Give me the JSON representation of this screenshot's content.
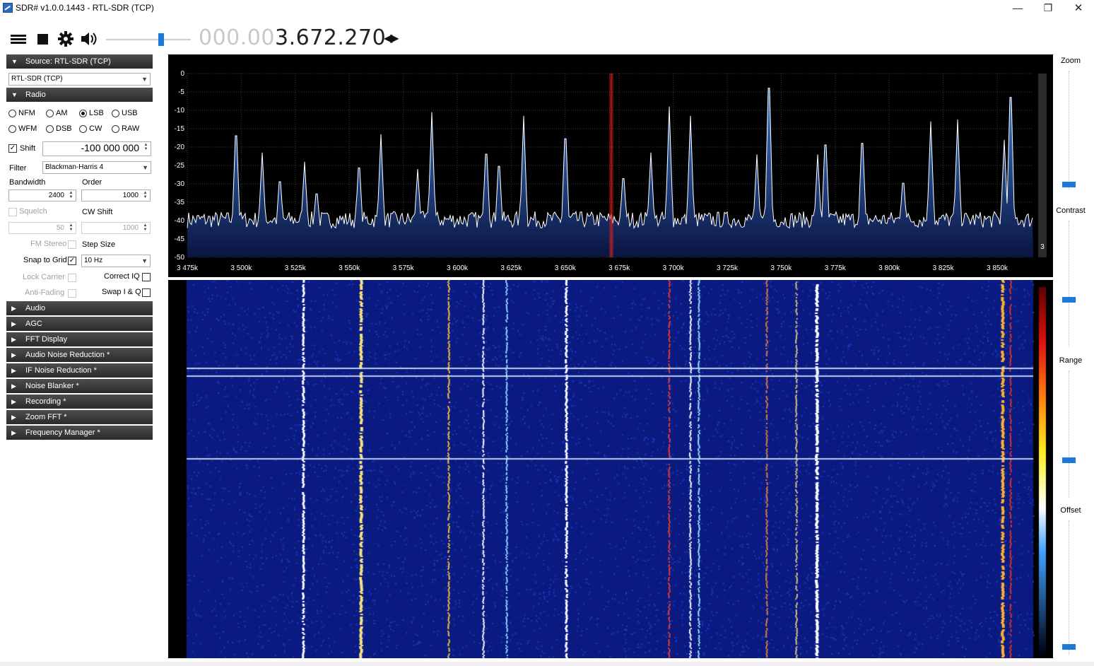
{
  "window": {
    "title": "SDR# v1.0.0.1443 - RTL-SDR (TCP)",
    "minimize_glyph": "—",
    "restore_glyph": "❐",
    "close_glyph": "✕"
  },
  "toolbar": {
    "volume_level": 0.66,
    "frequency_dim": "000.00",
    "frequency_main": "3.672.270",
    "freq_arrows": "◀▶"
  },
  "source": {
    "header": "Source: RTL-SDR (TCP)",
    "device": "RTL-SDR (TCP)"
  },
  "radio": {
    "header": "Radio",
    "modes": [
      "NFM",
      "AM",
      "LSB",
      "USB",
      "WFM",
      "DSB",
      "CW",
      "RAW"
    ],
    "selected_mode": "LSB",
    "shift_label": "Shift",
    "shift_value": "-100 000 000",
    "filter_label": "Filter",
    "filter_value": "Blackman-Harris 4",
    "bandwidth_label": "Bandwidth",
    "bandwidth_value": "2400",
    "order_label": "Order",
    "order_value": "1000",
    "squelch_label": "Squelch",
    "squelch_value": "50",
    "cw_shift_label": "CW Shift",
    "cw_shift_value": "1000",
    "fm_stereo_label": "FM Stereo",
    "step_size_label": "Step Size",
    "snap_label": "Snap to Grid",
    "step_value": "10 Hz",
    "lock_carrier_label": "Lock Carrier",
    "correct_iq_label": "Correct IQ",
    "anti_fading_label": "Anti-Fading",
    "swap_iq_label": "Swap I & Q"
  },
  "sections": [
    "Audio",
    "AGC",
    "FFT Display",
    "Audio Noise Reduction *",
    "IF Noise Reduction *",
    "Noise Blanker *",
    "Recording *",
    "Zoom FFT *",
    "Frequency Manager *"
  ],
  "icons": {
    "menu": "menu-icon",
    "stop": "stop-icon",
    "settings": "gear-icon",
    "volume": "speaker-icon",
    "expanded": "▼",
    "collapsed": "▶",
    "check": "✓"
  },
  "right_panel": {
    "zoom_label": "Zoom",
    "contrast_label": "Contrast",
    "range_label": "Range",
    "offset_label": "Offset"
  },
  "spectrum": {
    "y_ticks": [
      "0",
      "-5",
      "-10",
      "-15",
      "-20",
      "-25",
      "-30",
      "-35",
      "-40",
      "-45",
      "-50"
    ],
    "x_ticks": [
      "3 475k",
      "3 500k",
      "3 525k",
      "3 550k",
      "3 575k",
      "3 600k",
      "3 625k",
      "3 650k",
      "3 675k",
      "3 700k",
      "3 725k",
      "3 750k",
      "3 775k",
      "3 800k",
      "3 825k",
      "3 850k"
    ],
    "scale_value": "3",
    "colors": {
      "background": "#000000",
      "grid": "#3a3a3a",
      "trace": "#ffffff",
      "fill_top": "#3d7ad0",
      "fill_bottom": "#0a1440",
      "tuned_marker": "#d02020",
      "waterfall_base": "#0a1a80"
    }
  }
}
